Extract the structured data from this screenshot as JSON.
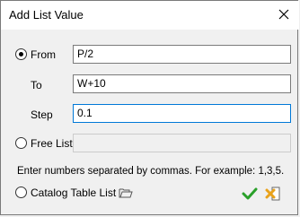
{
  "window": {
    "title": "Add List Value"
  },
  "options": {
    "from": {
      "label": "From",
      "value": "P/2",
      "selected": true
    },
    "to": {
      "label": "To",
      "value": "W+10"
    },
    "step": {
      "label": "Step",
      "value": "0.1"
    },
    "free_list": {
      "label": "Free List",
      "value": ""
    },
    "catalog": {
      "label": "Catalog Table List"
    }
  },
  "hint": "Enter numbers separated by commas. For example: 1,3,5.",
  "icons": {
    "close": "close-icon",
    "folder": "folder-open-icon",
    "ok": "checkmark-icon",
    "cancel": "cancel-icon"
  },
  "colors": {
    "accent": "#0078d7",
    "ok_green": "#2aa02a",
    "cancel_orange": "#e9a21b"
  }
}
